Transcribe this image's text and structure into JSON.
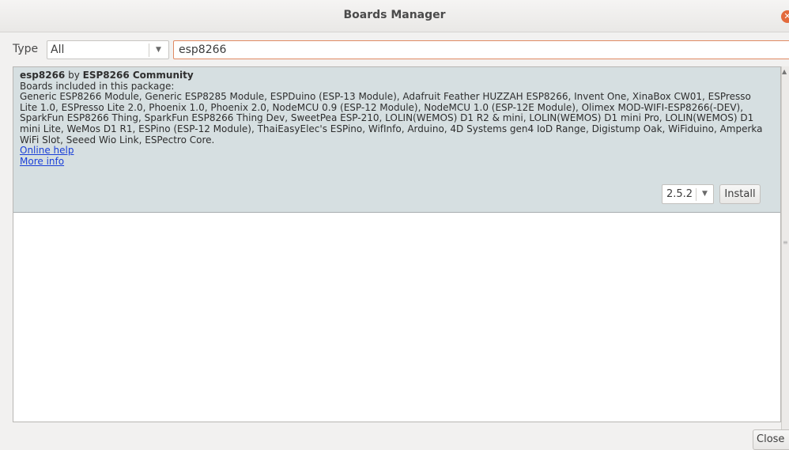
{
  "window": {
    "title": "Boards Manager"
  },
  "filter": {
    "type_label": "Type",
    "type_selected": "All",
    "search_value": "esp8266"
  },
  "board": {
    "name": "esp8266",
    "by": "by",
    "author": "ESP8266 Community",
    "included_label": "Boards included in this package:",
    "boards_list": "Generic ESP8266 Module, Generic ESP8285 Module, ESPDuino (ESP-13 Module), Adafruit Feather HUZZAH ESP8266, Invent One, XinaBox CW01, ESPresso Lite 1.0, ESPresso Lite 2.0, Phoenix 1.0, Phoenix 2.0, NodeMCU 0.9 (ESP-12 Module), NodeMCU 1.0 (ESP-12E Module), Olimex MOD-WIFI-ESP8266(-DEV), SparkFun ESP8266 Thing, SparkFun ESP8266 Thing Dev, SweetPea ESP-210, LOLIN(WEMOS) D1 R2 & mini, LOLIN(WEMOS) D1 mini Pro, LOLIN(WEMOS) D1 mini Lite, WeMos D1 R1, ESPino (ESP-12 Module), ThaiEasyElec's ESPino, WifInfo, Arduino, 4D Systems gen4 IoD Range, Digistump Oak, WiFiduino, Amperka WiFi Slot, Seeed Wio Link, ESPectro Core.",
    "online_help": "Online help",
    "more_info": "More info",
    "version": "2.5.2",
    "install_label": "Install"
  },
  "footer": {
    "close_label": "Close"
  },
  "icons": {
    "window_close": "close-icon",
    "dropdown": "chevron-down-icon"
  },
  "colors": {
    "selected_item_bg": "#d6dfe1",
    "link": "#1a3fd8",
    "focus_border": "#e08a63",
    "window_close": "#e36a3c"
  }
}
